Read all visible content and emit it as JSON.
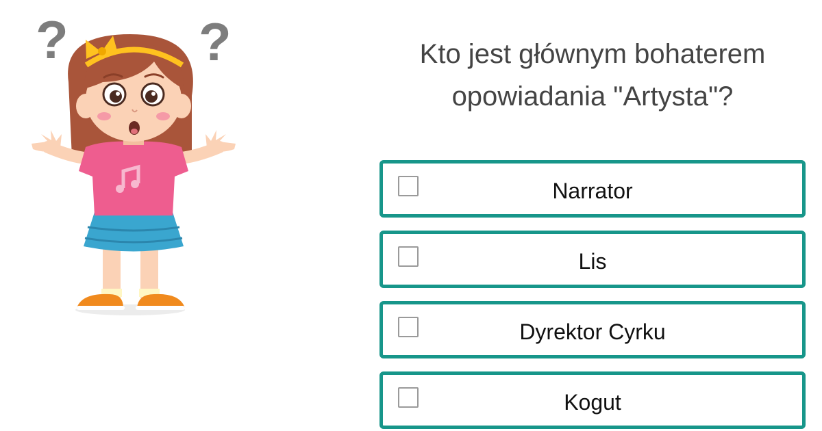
{
  "question": {
    "text": "Kto jest głównym bohaterem opowiadania \"Artysta\"?"
  },
  "illustration": {
    "icon": "confused-girl-illustration"
  },
  "answers": [
    {
      "label": "Narrator",
      "checked": false
    },
    {
      "label": "Lis",
      "checked": false
    },
    {
      "label": "Dyrektor Cyrku",
      "checked": false
    },
    {
      "label": "Kogut",
      "checked": false
    }
  ],
  "colors": {
    "accent": "#17968a",
    "question_text": "#444444",
    "answer_text": "#111111",
    "checkbox_border": "#9a9a9a"
  }
}
